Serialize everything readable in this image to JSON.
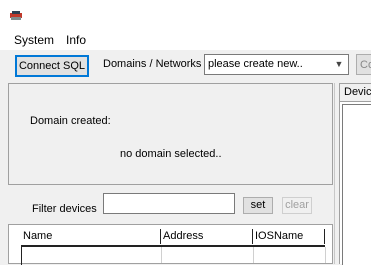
{
  "menu": {
    "system": "System",
    "info": "Info"
  },
  "toolbar": {
    "connect_label": "Connect SQL",
    "domains_label": "Domains / Networks",
    "domain_select_value": "please create new..",
    "right_button_label": "Co"
  },
  "domain_panel": {
    "created_label": "Domain created:",
    "status_text": "no domain selected.."
  },
  "filter": {
    "label": "Filter devices",
    "value": "",
    "set_label": "set",
    "clear_label": "clear"
  },
  "device_table": {
    "columns": [
      "Name",
      "Address",
      "IOSName"
    ]
  },
  "right_panel": {
    "header": "Device"
  }
}
